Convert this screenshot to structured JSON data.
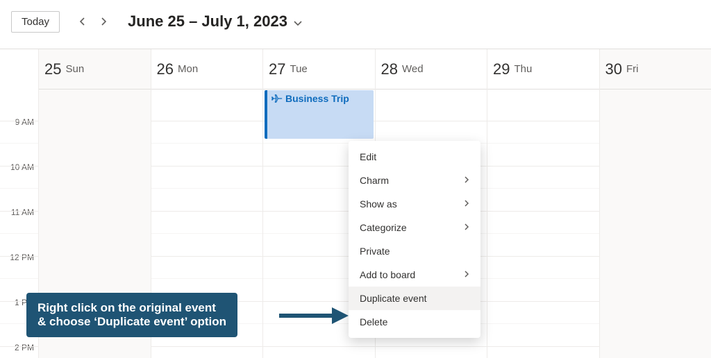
{
  "toolbar": {
    "today_label": "Today",
    "date_range": "June 25 – July 1, 2023"
  },
  "time_slots": [
    "9 AM",
    "10 AM",
    "11 AM",
    "12 PM",
    "1 PM",
    "2 PM"
  ],
  "days": [
    {
      "num": "25",
      "name": "Sun"
    },
    {
      "num": "26",
      "name": "Mon"
    },
    {
      "num": "27",
      "name": "Tue"
    },
    {
      "num": "28",
      "name": "Wed"
    },
    {
      "num": "29",
      "name": "Thu"
    },
    {
      "num": "30",
      "name": "Fri"
    }
  ],
  "event": {
    "title": "Business Trip"
  },
  "context_menu": {
    "edit": "Edit",
    "charm": "Charm",
    "show_as": "Show as",
    "categorize": "Categorize",
    "private": "Private",
    "add_to_board": "Add to board",
    "duplicate": "Duplicate event",
    "delete": "Delete"
  },
  "annotation": {
    "line1": "Right click on the original event",
    "line2": "& choose ‘Duplicate event’ option"
  }
}
